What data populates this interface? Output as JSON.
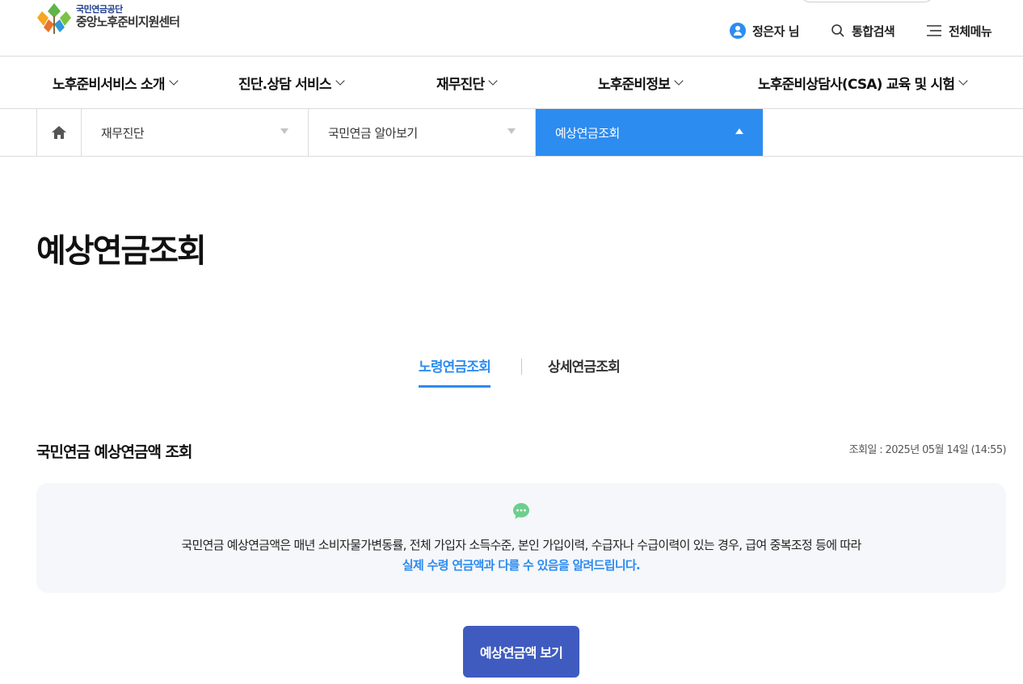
{
  "header": {
    "logo_org": "국민연금공단",
    "logo_center": "중앙노후준비지원센터",
    "user_label": "정은자 님",
    "search_label": "통합검색",
    "menu_label": "전체메뉴"
  },
  "gnb": {
    "items": [
      {
        "label": "노후준비서비스 소개"
      },
      {
        "label": "진단.상담 서비스"
      },
      {
        "label": "재무진단"
      },
      {
        "label": "노후준비정보"
      },
      {
        "label": "노후준비상담사(CSA) 교육 및 시험"
      }
    ]
  },
  "breadcrumb": {
    "level1": "재무진단",
    "level2": "국민연금 알아보기",
    "level3": "예상연금조회"
  },
  "page": {
    "title": "예상연금조회"
  },
  "tabs": [
    {
      "label": "노령연금조회",
      "active": true
    },
    {
      "label": "상세연금조회",
      "active": false
    }
  ],
  "section": {
    "title": "국민연금 예상연금액 조회",
    "query_date": "조회일 : 2025년 05월 14일 (14:55)"
  },
  "notice": {
    "line1": "국민연금 예상연금액은 매년 소비자물가변동률, 전체 가입자 소득수준, 본인 가입이력, 수급자나 수급이력이 있는 경우, 급여 중복조정 등에 따라",
    "line2": "실제 수령 연금액과 다를 수 있음을 알려드립니다."
  },
  "actions": {
    "view_button": "예상연금액 보기"
  },
  "colors": {
    "accent": "#2d8cf0",
    "button": "#3f5bbf",
    "notice_bg": "#f5f7fa"
  }
}
